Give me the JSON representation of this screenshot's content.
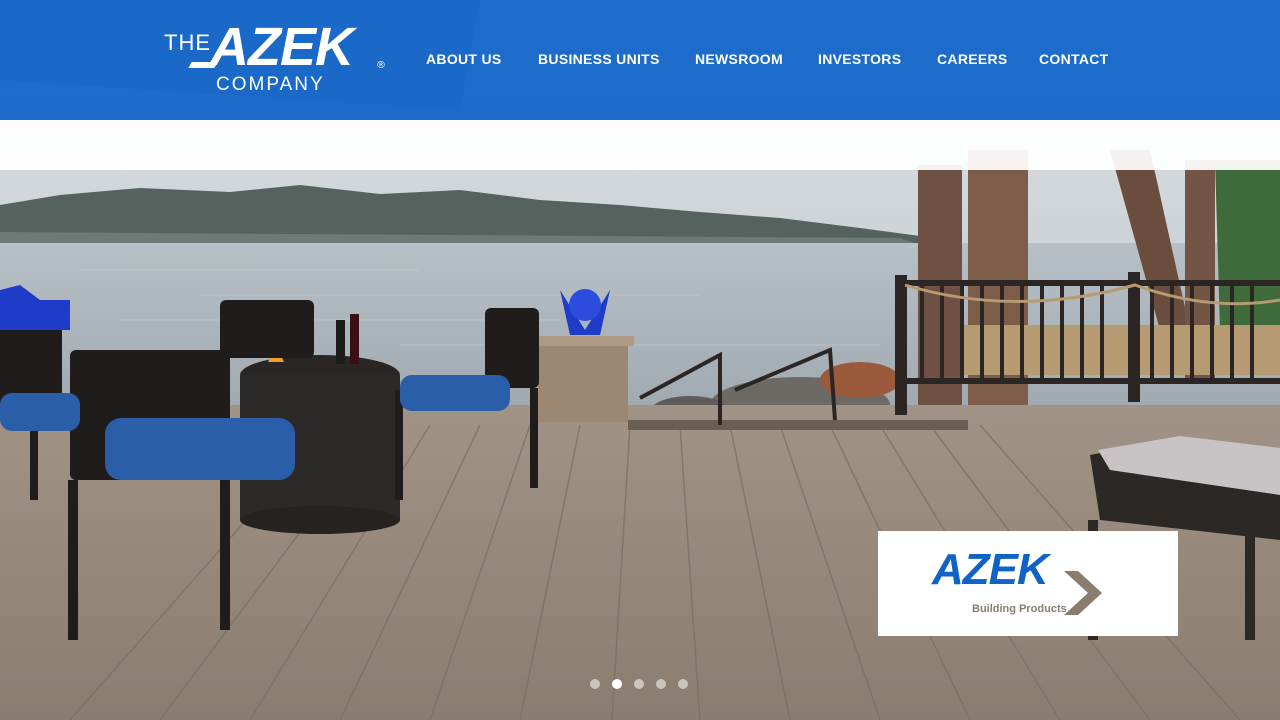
{
  "header": {
    "logo": {
      "prefix": "THE",
      "wordmark": "AZEK",
      "registered": "®",
      "suffix": "COMPANY"
    },
    "nav": [
      {
        "label": "ABOUT US"
      },
      {
        "label": "BUSINESS UNITS"
      },
      {
        "label": "NEWSROOM"
      },
      {
        "label": "INVESTORS"
      },
      {
        "label": "CAREERS"
      },
      {
        "label": "CONTACT"
      }
    ]
  },
  "hero": {
    "brand_badge": {
      "wordmark": "AZEK",
      "subtitle": "Building Products"
    },
    "carousel": {
      "slide_count": 5,
      "active_index": 1
    }
  },
  "colors": {
    "brand_blue": "#0e62c8",
    "badge_taupe": "#8a7d6e"
  }
}
